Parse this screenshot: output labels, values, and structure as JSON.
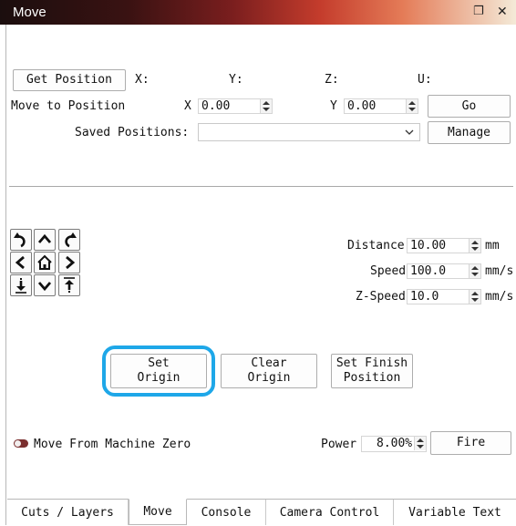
{
  "window": {
    "title": "Move"
  },
  "position": {
    "get_button": "Get Position",
    "x_label": "X:",
    "y_label": "Y:",
    "z_label": "Z:",
    "u_label": "U:"
  },
  "move_to": {
    "label": "Move to Position",
    "x_label": "X",
    "x_value": "0.00",
    "y_label": "Y",
    "y_value": "0.00",
    "go_button": "Go"
  },
  "saved": {
    "label": "Saved Positions:",
    "value": "",
    "manage_button": "Manage"
  },
  "jog": {
    "distance_label": "Distance",
    "distance_value": "10.00",
    "distance_unit": "mm",
    "speed_label": "Speed",
    "speed_value": "100.0",
    "speed_unit": "mm/s",
    "zspeed_label": "Z-Speed",
    "zspeed_value": "10.0",
    "zspeed_unit": "mm/s"
  },
  "origin": {
    "set_button": "Set\nOrigin",
    "clear_button": "Clear\nOrigin",
    "finish_button": "Set Finish\nPosition",
    "highlight_color": "#1ea7e8"
  },
  "machine_zero": {
    "label": "Move From Machine Zero",
    "checked": false
  },
  "power": {
    "label": "Power",
    "value": "8.00%",
    "fire_button": "Fire"
  },
  "tabs": [
    "Cuts / Layers",
    "Move",
    "Console",
    "Camera Control",
    "Variable Text"
  ],
  "active_tab": "Move"
}
